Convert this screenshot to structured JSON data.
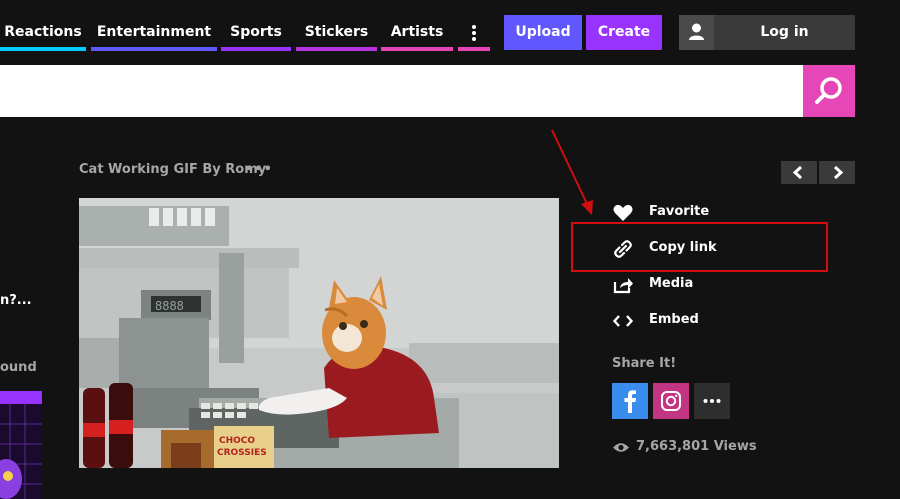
{
  "nav": {
    "items": [
      {
        "label": "Reactions",
        "color": "#00ccff"
      },
      {
        "label": "Entertainment",
        "color": "#6157ff"
      },
      {
        "label": "Sports",
        "color": "#9933ff"
      },
      {
        "label": "Stickers",
        "color": "#b533dd"
      },
      {
        "label": "Artists",
        "color": "#e646b6"
      }
    ],
    "more_color": "#e646b6"
  },
  "header": {
    "upload_label": "Upload",
    "upload_color": "#6157ff",
    "create_label": "Create",
    "create_color": "#9933ff",
    "login_label": "Log in"
  },
  "search": {
    "value": "",
    "placeholder": "",
    "button_color": "#e646b6"
  },
  "gif": {
    "title": "Cat Working GIF By Romy",
    "more": "•••"
  },
  "actions": {
    "favorite": "Favorite",
    "copy_link": "Copy link",
    "media": "Media",
    "embed": "Embed"
  },
  "share": {
    "title": "Share It!",
    "facebook_color": "#3b8ded",
    "instagram_color": "#c13584",
    "more_color": "#2e2e2e"
  },
  "views": {
    "text": "7,663,801 Views"
  },
  "left_column": {
    "fragment_1": "n?...",
    "fragment_2": "ound"
  },
  "annotation_color": "#d10d0d"
}
